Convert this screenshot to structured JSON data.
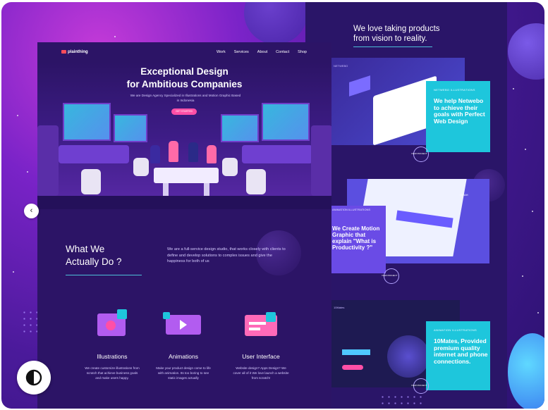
{
  "colors": {
    "accent_cyan": "#1ec6dc",
    "brand_pink": "#ff4fa6",
    "page_dark": "#2c1466",
    "right_col": "#2a1568"
  },
  "nav": {
    "logo": "plainthing",
    "links": [
      "Work",
      "Services",
      "About",
      "Contact",
      "Shop"
    ]
  },
  "hero": {
    "title": "Exceptional Design\nfor Ambitious Companies",
    "subtitle": "We are Design Agency Specialized in Illustrations and Motion Graphic Based in Indonesia",
    "cta": "GET STARTED"
  },
  "about": {
    "title": "What We\nActually Do ?",
    "description": "We are a full-service design studio, that works closely with clients to define and develop solutions to complex issues and give the happiness for both of us"
  },
  "services": [
    {
      "name": "Illustrations",
      "icon": "illustration-icon",
      "desc": "We create customize illustrations from scratch that achieve business goals and make users happy."
    },
    {
      "name": "Animations",
      "icon": "animation-icon",
      "desc": "Make your product design come to life with animation. Its too boring to see static images actually"
    },
    {
      "name": "User Interface",
      "icon": "ui-icon",
      "desc": "Website design? Apps Design? We cover all of it We love launch a website from scratch!"
    }
  ],
  "right": {
    "tagline": "We love taking products\nfrom vision to reality.",
    "cards": [
      {
        "tags": "NETWEBO     ILLUSTRATIONS",
        "text": "We help Netwebo to achieve their goals with Perfect Web Design",
        "label": "NETWEBO",
        "ring": "VIEW PROJECT"
      },
      {
        "tags": "ANIMATION     ILLUSTRATIONS",
        "text": "We Create Motion Graphic that explain \"What is Productivity ?\"",
        "label": "ODAH",
        "ring": "VIEW PROJECT"
      },
      {
        "tags": "ANIMATION     ILLUSTRATIONS",
        "text": "10Mates, Provided premium quality internet and phone connections.",
        "label": "10Mates",
        "ring": "VIEW PROJECT"
      }
    ]
  },
  "controls": {
    "prev": "‹",
    "contrast_icon": "contrast-icon"
  }
}
